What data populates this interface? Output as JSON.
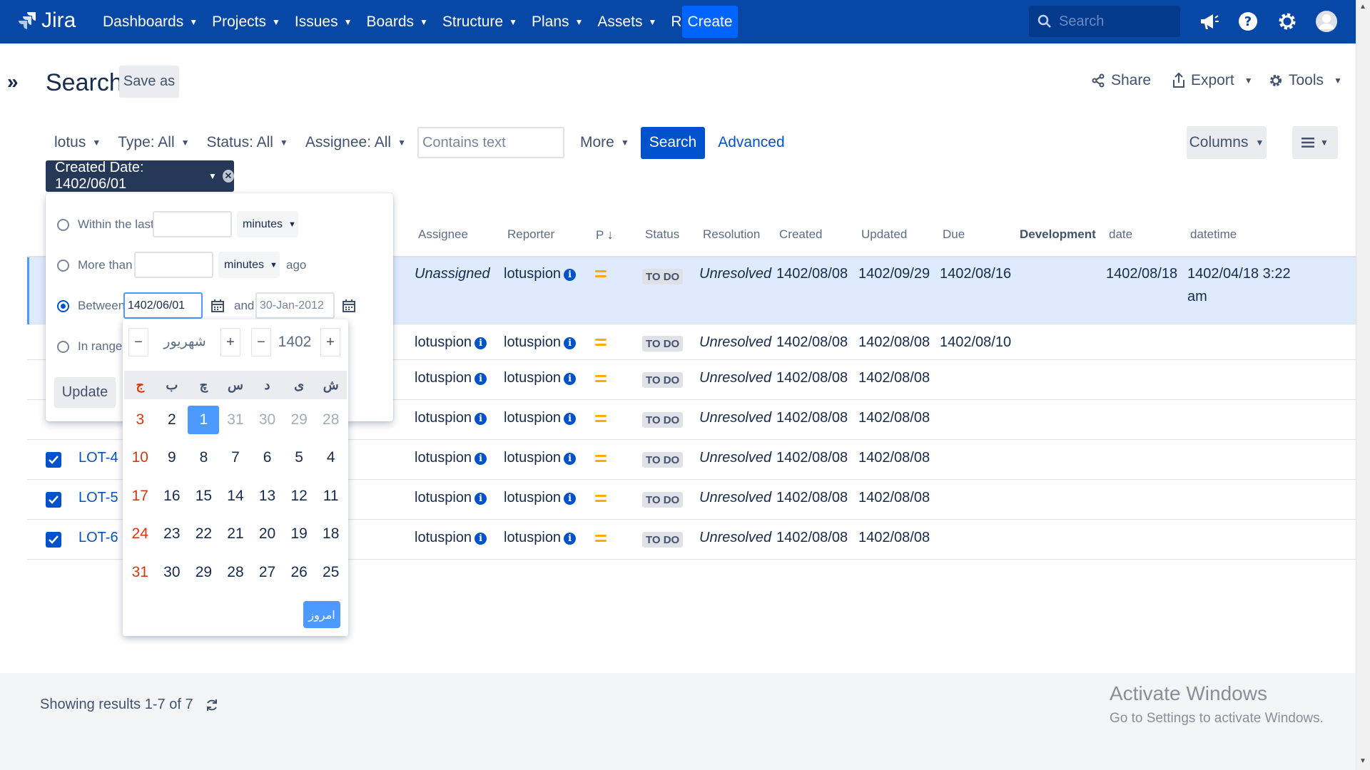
{
  "app": {
    "logo_text": "Jira"
  },
  "nav": {
    "items": [
      {
        "label": "Dashboards"
      },
      {
        "label": "Projects"
      },
      {
        "label": "Issues"
      },
      {
        "label": "Boards"
      },
      {
        "label": "Structure"
      },
      {
        "label": "Plans"
      },
      {
        "label": "Assets"
      },
      {
        "label": "Refined"
      }
    ],
    "create_label": "Create",
    "search_placeholder": "Search"
  },
  "page": {
    "title": "Search",
    "save_as": "Save as",
    "share": "Share",
    "export": "Export",
    "tools": "Tools"
  },
  "filters": {
    "project": "lotus",
    "type": "Type: All",
    "status": "Status: All",
    "assignee": "Assignee: All",
    "text_placeholder": "Contains text",
    "more": "More",
    "search": "Search",
    "advanced": "Advanced",
    "columns": "Columns",
    "active_filter": "Created Date: 1402/06/01"
  },
  "table": {
    "headers": {
      "assignee": "Assignee",
      "reporter": "Reporter",
      "priority": "P",
      "status": "Status",
      "resolution": "Resolution",
      "created": "Created",
      "updated": "Updated",
      "due": "Due",
      "development": "Development",
      "date": "date",
      "datetime": "datetime"
    },
    "rows": [
      {
        "key": "",
        "assignee": "Unassigned",
        "reporter": "lotuspion",
        "status": "TO DO",
        "resolution": "Unresolved",
        "created": "1402/08/08",
        "updated": "1402/09/29",
        "due": "1402/08/16",
        "date": "1402/08/18",
        "datetime1": "1402/04/18 3:22",
        "datetime2": "am"
      },
      {
        "key": "",
        "assignee": "lotuspion",
        "reporter": "lotuspion",
        "status": "TO DO",
        "resolution": "Unresolved",
        "created": "1402/08/08",
        "updated": "1402/08/08",
        "due": "1402/08/10",
        "date": "",
        "datetime1": "",
        "datetime2": ""
      },
      {
        "key": "",
        "assignee": "lotuspion",
        "reporter": "lotuspion",
        "status": "TO DO",
        "resolution": "Unresolved",
        "created": "1402/08/08",
        "updated": "1402/08/08",
        "due": "",
        "date": "",
        "datetime1": "",
        "datetime2": ""
      },
      {
        "key": "",
        "assignee": "lotuspion",
        "reporter": "lotuspion",
        "status": "TO DO",
        "resolution": "Unresolved",
        "created": "1402/08/08",
        "updated": "1402/08/08",
        "due": "",
        "date": "",
        "datetime1": "",
        "datetime2": ""
      },
      {
        "key": "LOT-4",
        "assignee": "lotuspion",
        "reporter": "lotuspion",
        "status": "TO DO",
        "resolution": "Unresolved",
        "created": "1402/08/08",
        "updated": "1402/08/08",
        "due": "",
        "date": "",
        "datetime1": "",
        "datetime2": ""
      },
      {
        "key": "LOT-5",
        "assignee": "lotuspion",
        "reporter": "lotuspion",
        "status": "TO DO",
        "resolution": "Unresolved",
        "created": "1402/08/08",
        "updated": "1402/08/08",
        "due": "",
        "date": "",
        "datetime1": "",
        "datetime2": ""
      },
      {
        "key": "LOT-6",
        "assignee": "lotuspion",
        "reporter": "lotuspion",
        "status": "TO DO",
        "resolution": "Unresolved",
        "created": "1402/08/08",
        "updated": "1402/08/08",
        "due": "",
        "date": "",
        "datetime1": "",
        "datetime2": ""
      }
    ]
  },
  "date_popup": {
    "within_label": "Within the last",
    "within_value": "",
    "within_unit": "minutes",
    "more_than_label": "More than",
    "more_than_value": "",
    "more_than_unit": "minutes",
    "ago": "ago",
    "between_label": "Between",
    "between_from": "1402/06/01",
    "and": "and",
    "between_to": "30-Jan-2012",
    "in_range_label": "In range",
    "update": "Update"
  },
  "calendar": {
    "month": "شهریور",
    "year": "1402",
    "dec": "−",
    "inc": "+",
    "weekdays": [
      "ج",
      "ب",
      "چ",
      "س",
      "د",
      "ی",
      "ش"
    ],
    "rows": [
      [
        "3",
        "2",
        "1",
        "31",
        "30",
        "29",
        "28"
      ],
      [
        "10",
        "9",
        "8",
        "7",
        "6",
        "5",
        "4"
      ],
      [
        "17",
        "16",
        "15",
        "14",
        "13",
        "12",
        "11"
      ],
      [
        "24",
        "23",
        "22",
        "21",
        "20",
        "19",
        "18"
      ],
      [
        "31",
        "30",
        "29",
        "28",
        "27",
        "26",
        "25"
      ]
    ],
    "today_label": "امروز"
  },
  "footer": {
    "results": "Showing results 1-7 of 7"
  },
  "watermark": {
    "line1": "Activate Windows",
    "line2": "Go to Settings to activate Windows."
  },
  "colors": {
    "nav_bg": "#0747a6",
    "primary": "#0052cc",
    "selected_row": "#deebff",
    "weekend_red": "#de350b"
  }
}
